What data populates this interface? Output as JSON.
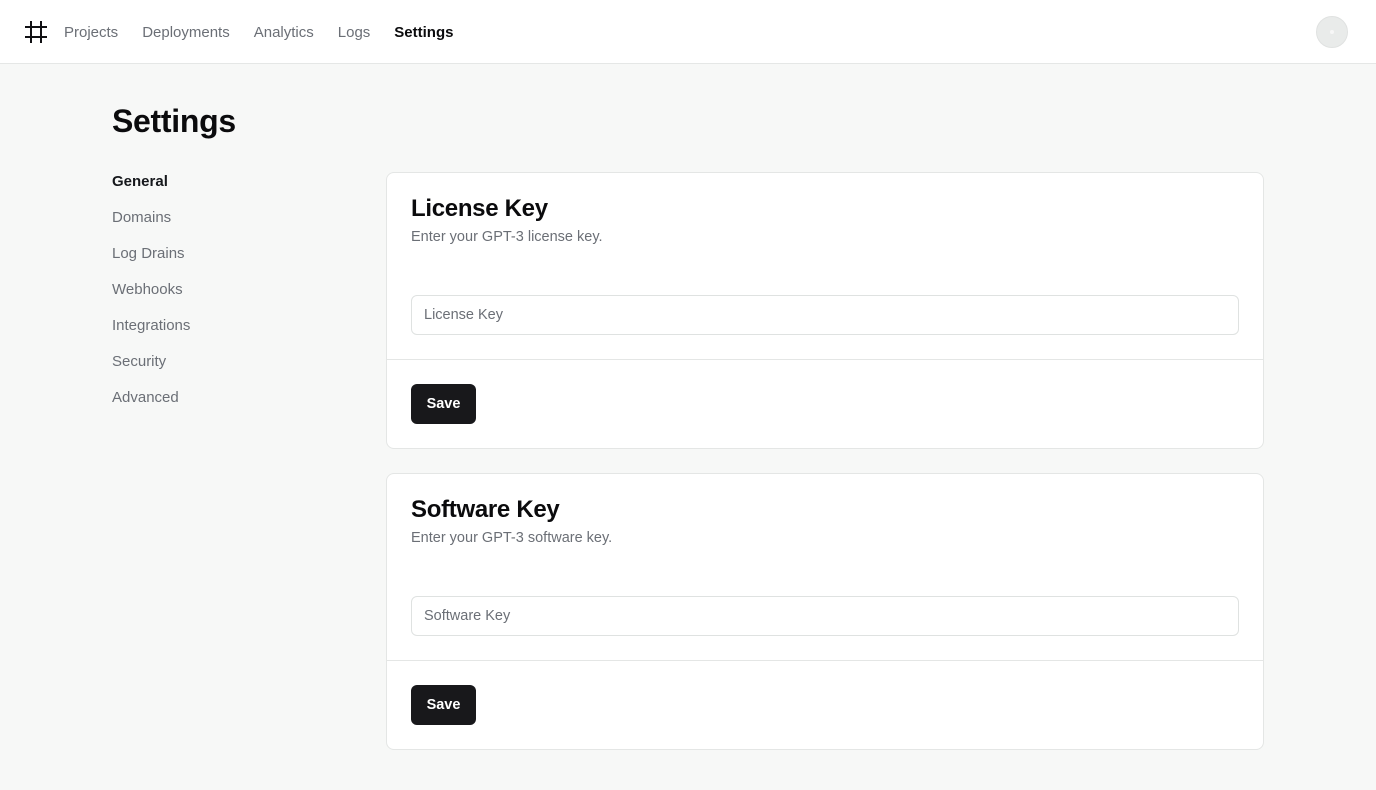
{
  "header": {
    "logo_icon": "hash-grid-icon",
    "nav": [
      {
        "label": "Projects",
        "active": false
      },
      {
        "label": "Deployments",
        "active": false
      },
      {
        "label": "Analytics",
        "active": false
      },
      {
        "label": "Logs",
        "active": false
      },
      {
        "label": "Settings",
        "active": true
      }
    ],
    "avatar_icon": "user-avatar-icon"
  },
  "page": {
    "title": "Settings"
  },
  "sidebar": {
    "items": [
      {
        "label": "General",
        "active": true
      },
      {
        "label": "Domains",
        "active": false
      },
      {
        "label": "Log Drains",
        "active": false
      },
      {
        "label": "Webhooks",
        "active": false
      },
      {
        "label": "Integrations",
        "active": false
      },
      {
        "label": "Security",
        "active": false
      },
      {
        "label": "Advanced",
        "active": false
      }
    ]
  },
  "cards": [
    {
      "title": "License Key",
      "description": "Enter your GPT-3 license key.",
      "input_placeholder": "License Key",
      "input_value": "",
      "button_label": "Save"
    },
    {
      "title": "Software Key",
      "description": "Enter your GPT-3 software key.",
      "input_placeholder": "Software Key",
      "input_value": "",
      "button_label": "Save"
    }
  ],
  "colors": {
    "page_background": "#f7f8f7",
    "header_background": "#ffffff",
    "primary_button": "#18181b",
    "muted_text": "#6b6f76",
    "border": "#e4e6e5"
  }
}
